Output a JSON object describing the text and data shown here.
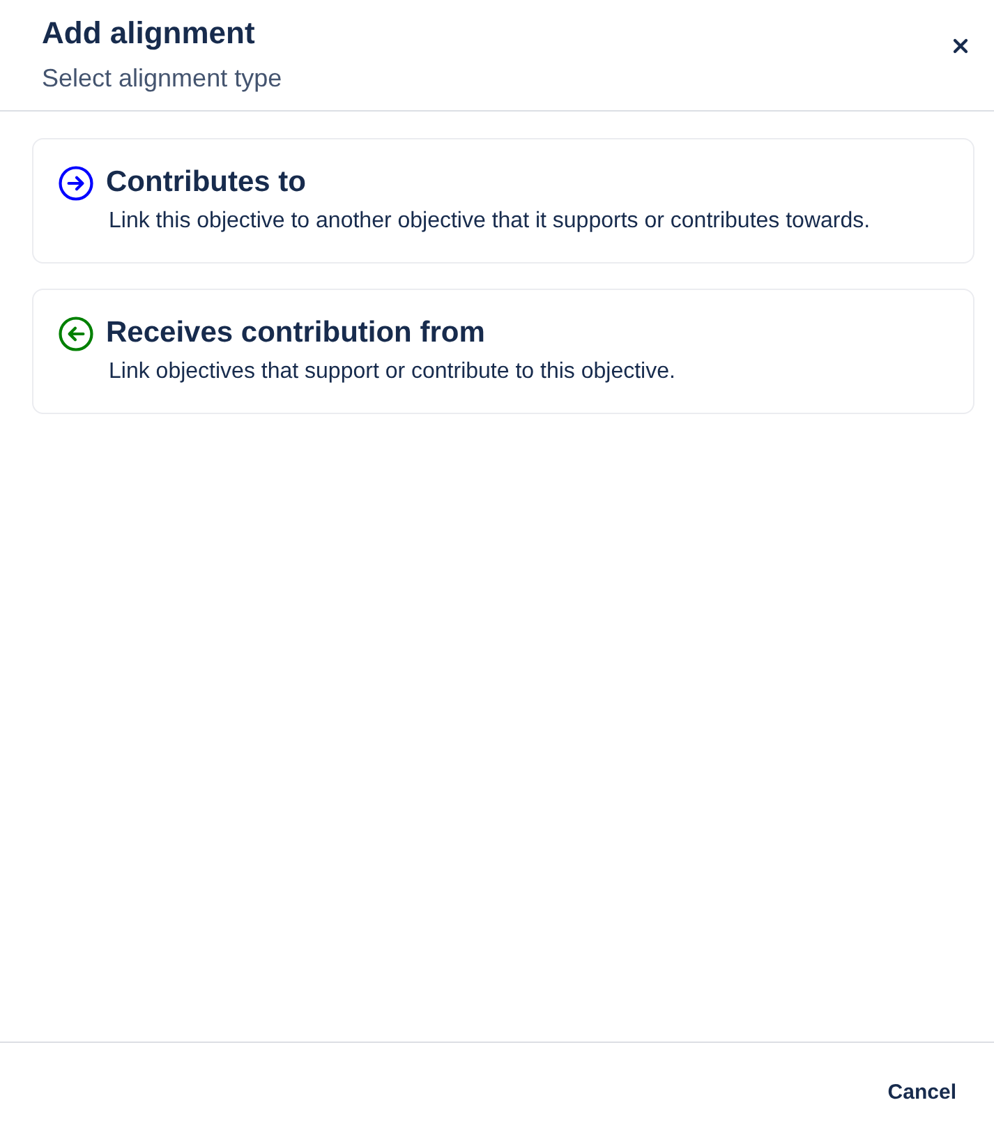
{
  "dialog": {
    "title": "Add alignment",
    "subtitle": "Select alignment type"
  },
  "options": [
    {
      "kind": "outgoing",
      "color": "#0000ff",
      "title": "Contributes to",
      "description": "Link this objective to another objective that it supports or contributes towards."
    },
    {
      "kind": "incoming",
      "color": "#008000",
      "title": "Receives contribution from",
      "description": "Link objectives that support or contribute to this objective."
    }
  ],
  "footer": {
    "buttons": [
      "Cancel"
    ]
  }
}
